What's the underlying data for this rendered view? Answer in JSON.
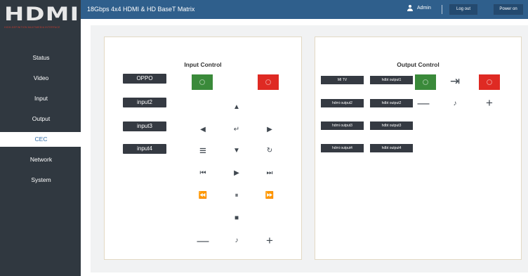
{
  "header": {
    "title": "18Gbps 4x4 HDMI & HD BaseT Matrix",
    "user": "Admin",
    "logout_label": "Log out",
    "poweron_label": "Power on"
  },
  "logo": {
    "text": "HDMI",
    "tagline": "HIGH-DEFINITION MULTIMEDIA INTERFACE"
  },
  "sidebar": {
    "items": [
      {
        "label": "Status"
      },
      {
        "label": "Video"
      },
      {
        "label": "Input"
      },
      {
        "label": "Output"
      },
      {
        "label": "CEC"
      },
      {
        "label": "Network"
      },
      {
        "label": "System"
      }
    ],
    "active": "CEC"
  },
  "input_control": {
    "title": "Input Control",
    "sources": [
      "OPPO",
      "input2",
      "input3",
      "input4"
    ],
    "icons": {
      "power_on": "power-icon",
      "power_off": "power-icon",
      "up": "▲",
      "left": "◀",
      "enter": "↵",
      "right": "▶",
      "menu": "≡",
      "down": "▼",
      "back": "↻",
      "prev": "⏮",
      "play": "▶",
      "next": "⏭",
      "rewind": "⏪",
      "pause": "⏸",
      "forward": "⏩",
      "stop": "■",
      "vol_down": "—",
      "mute": "♪",
      "vol_up": "+"
    }
  },
  "output_control": {
    "title": "Output Control",
    "rows": [
      {
        "left": "MI TV",
        "right": "hdbt output1"
      },
      {
        "left": "hdmi output2",
        "right": "hdbt output2"
      },
      {
        "left": "hdmi output3",
        "right": "hdbt output3"
      },
      {
        "left": "hdmi output4",
        "right": "hdbt output4"
      }
    ],
    "icons": {
      "source": "⇥",
      "vol_down": "—",
      "mute": "♪",
      "vol_up": "+"
    }
  },
  "colors": {
    "header_bg": "#2f5f8c",
    "sidebar_bg": "#303840",
    "power_on": "#3a8a3a",
    "power_off": "#df2a23",
    "label_bg": "#353a42"
  }
}
